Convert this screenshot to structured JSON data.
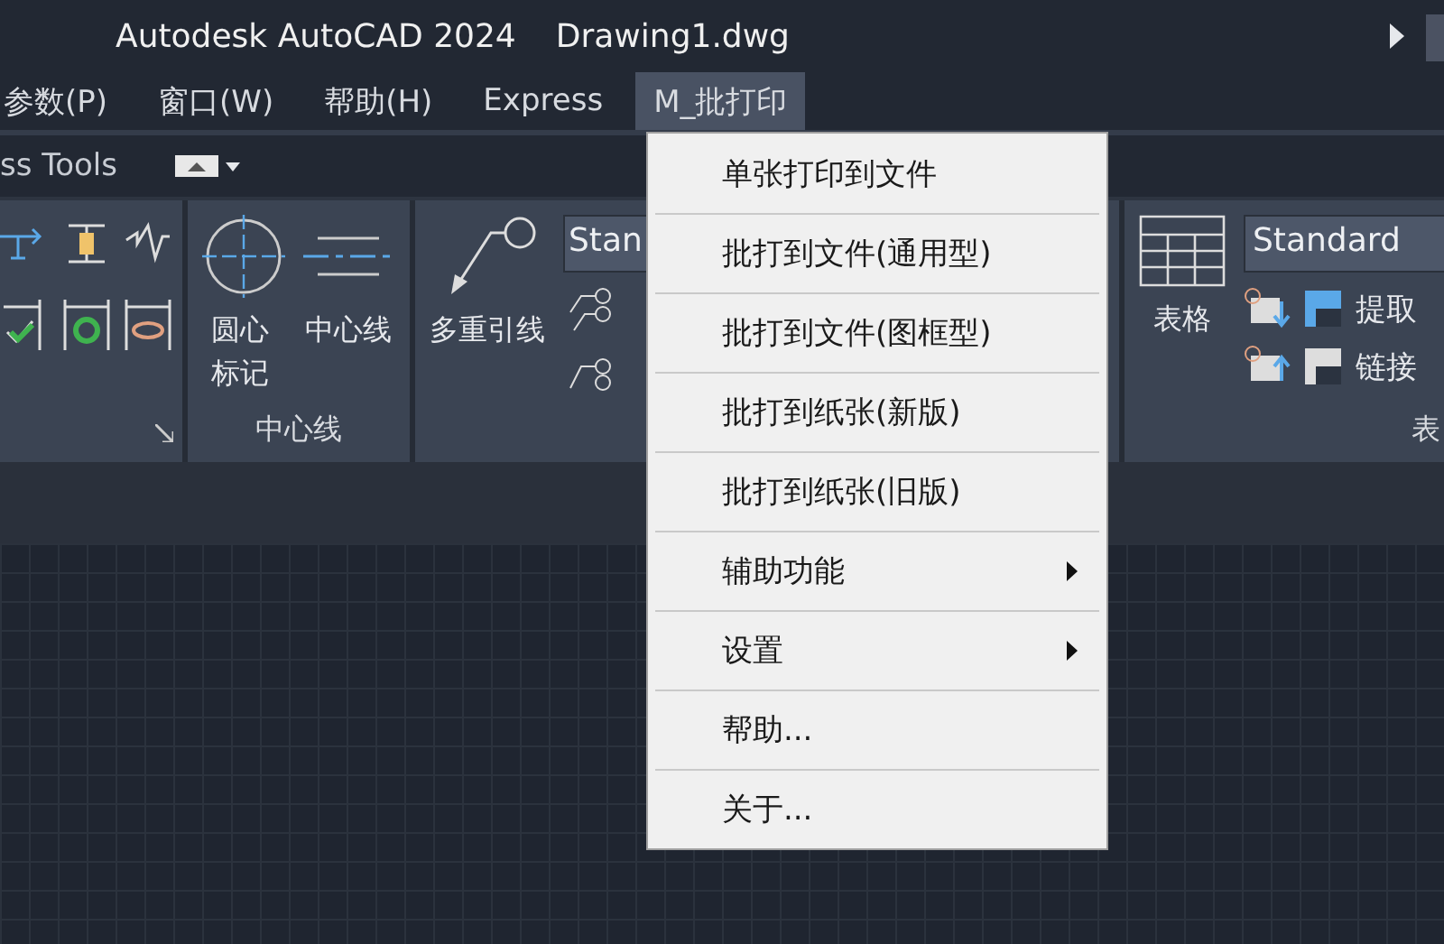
{
  "window": {
    "title": "Autodesk AutoCAD 2024",
    "document": "Drawing1.dwg"
  },
  "menubar": [
    {
      "label": "参数(P)",
      "selected": false
    },
    {
      "label": "窗口(W)",
      "selected": false
    },
    {
      "label": "帮助(H)",
      "selected": false
    },
    {
      "label": "Express",
      "selected": false
    },
    {
      "label": "M_批打印",
      "selected": true
    }
  ],
  "ribbon_tab_row": {
    "label": "ss Tools"
  },
  "ribbon": {
    "center_panel": {
      "buttons": [
        "圆心标记",
        "中心线"
      ],
      "title": "中心线"
    },
    "leader_panel": {
      "button": "多重引线",
      "style": "Stan"
    },
    "table_panel": {
      "button": "表格",
      "style": "Standard",
      "actions": [
        "提取",
        "链接"
      ],
      "title": "表"
    }
  },
  "dropdown": [
    {
      "label": "单张打印到文件",
      "kind": "command"
    },
    {
      "label": "批打到文件(通用型)",
      "kind": "command"
    },
    {
      "label": "批打到文件(图框型)",
      "kind": "command"
    },
    {
      "label": "批打到纸张(新版)",
      "kind": "command"
    },
    {
      "label": "批打到纸张(旧版)",
      "kind": "command"
    },
    {
      "label": "辅助功能",
      "kind": "submenu"
    },
    {
      "label": "设置",
      "kind": "submenu"
    },
    {
      "label": "帮助...",
      "kind": "command"
    },
    {
      "label": "关于...",
      "kind": "command"
    }
  ]
}
